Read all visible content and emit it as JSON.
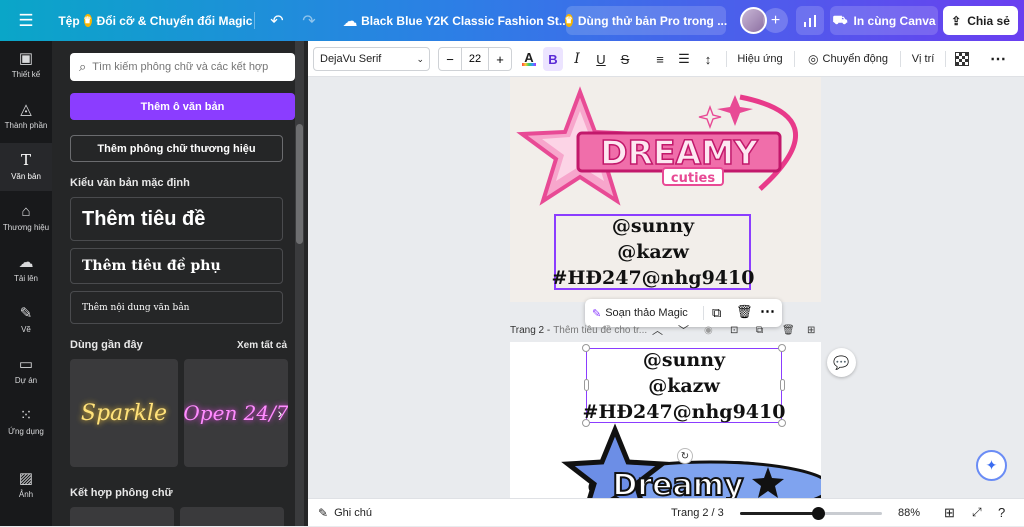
{
  "topbar": {
    "file_label": "Tệp",
    "magic_label": "Đổi cỡ & Chuyển đổi Magic",
    "doc_title": "Black Blue Y2K Classic Fashion St...",
    "pro_label": "Dùng thử bản Pro trong ...",
    "print_label": "In cùng Canva",
    "share_label": "Chia sẻ"
  },
  "leftnav": {
    "items": [
      {
        "label": "Thiết kế"
      },
      {
        "label": "Thành phần"
      },
      {
        "label": "Văn bản"
      },
      {
        "label": "Thương hiệu"
      },
      {
        "label": "Tải lên"
      },
      {
        "label": "Vẽ"
      },
      {
        "label": "Dự án"
      },
      {
        "label": "Ứng dụng"
      },
      {
        "label": "Ảnh"
      }
    ]
  },
  "panel": {
    "search_placeholder": "Tìm kiếm phông chữ và các kết hợp",
    "add_textbox": "Thêm ô văn bản",
    "add_brand_font": "Thêm phông chữ thương hiệu",
    "default_styles_label": "Kiểu văn bản mặc định",
    "heading": "Thêm tiêu đề",
    "subheading": "Thêm tiêu đề phụ",
    "body": "Thêm nội dung văn bản",
    "recent_label": "Dùng gần đây",
    "see_all": "Xem tất cả",
    "recent_1": "Sparkle",
    "recent_2": "Open 24/7",
    "combos_label": "Kết hợp phông chữ"
  },
  "toolbar": {
    "font_name": "DejaVu Serif",
    "font_size": "22",
    "effects": "Hiệu ứng",
    "animate": "Chuyển động",
    "position": "Vị trí"
  },
  "canvas": {
    "page1_text": [
      "@sunny",
      "@kazw",
      "#HĐ247@nhg9410"
    ],
    "logo_main": "DREAMY",
    "logo_sub": "cuties",
    "magic_write": "Soạn thảo Magic",
    "page2_label": "Trang 2 -",
    "page2_title_placeholder": "Thêm tiêu đề cho tr...",
    "page2_text": [
      "@sunny",
      "@kazw",
      "#HĐ247@nhg9410"
    ],
    "page2_logo": "Dreamy"
  },
  "bottombar": {
    "notes": "Ghi chú",
    "page_indicator": "Trang 2 / 3",
    "zoom": "88%"
  },
  "colors": {
    "accent": "#8b3dff",
    "selection": "#8b3dff",
    "pink": "#f06eaa"
  }
}
